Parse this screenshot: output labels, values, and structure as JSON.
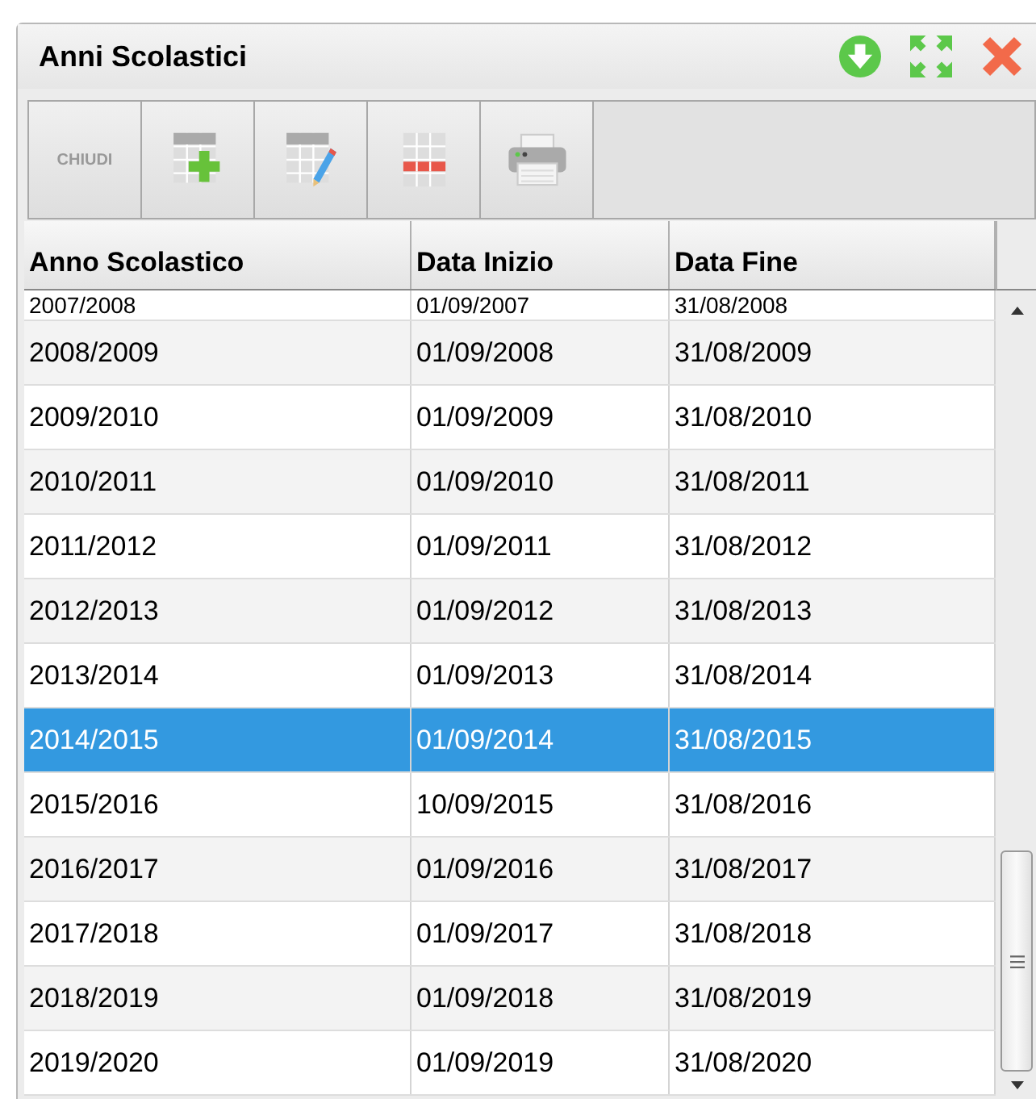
{
  "window": {
    "title": "Anni Scolastici"
  },
  "toolbar": [
    {
      "kind": "text",
      "label": "CHIUDI"
    },
    {
      "kind": "add"
    },
    {
      "kind": "edit"
    },
    {
      "kind": "delete"
    },
    {
      "kind": "print"
    }
  ],
  "table": {
    "columns": [
      "Anno Scolastico",
      "Data Inizio",
      "Data Fine"
    ],
    "rows": [
      {
        "cells": [
          "2007/2008",
          "01/09/2007",
          "31/08/2008"
        ],
        "selected": false
      },
      {
        "cells": [
          "2008/2009",
          "01/09/2008",
          "31/08/2009"
        ],
        "selected": false
      },
      {
        "cells": [
          "2009/2010",
          "01/09/2009",
          "31/08/2010"
        ],
        "selected": false
      },
      {
        "cells": [
          "2010/2011",
          "01/09/2010",
          "31/08/2011"
        ],
        "selected": false
      },
      {
        "cells": [
          "2011/2012",
          "01/09/2011",
          "31/08/2012"
        ],
        "selected": false
      },
      {
        "cells": [
          "2012/2013",
          "01/09/2012",
          "31/08/2013"
        ],
        "selected": false
      },
      {
        "cells": [
          "2013/2014",
          "01/09/2013",
          "31/08/2014"
        ],
        "selected": false
      },
      {
        "cells": [
          "2014/2015",
          "01/09/2014",
          "31/08/2015"
        ],
        "selected": true
      },
      {
        "cells": [
          "2015/2016",
          "10/09/2015",
          "31/08/2016"
        ],
        "selected": false
      },
      {
        "cells": [
          "2016/2017",
          "01/09/2016",
          "31/08/2017"
        ],
        "selected": false
      },
      {
        "cells": [
          "2017/2018",
          "01/09/2017",
          "31/08/2018"
        ],
        "selected": false
      },
      {
        "cells": [
          "2018/2019",
          "01/09/2018",
          "31/08/2019"
        ],
        "selected": false
      },
      {
        "cells": [
          "2019/2020",
          "01/09/2019",
          "31/08/2020"
        ],
        "selected": false
      }
    ]
  }
}
